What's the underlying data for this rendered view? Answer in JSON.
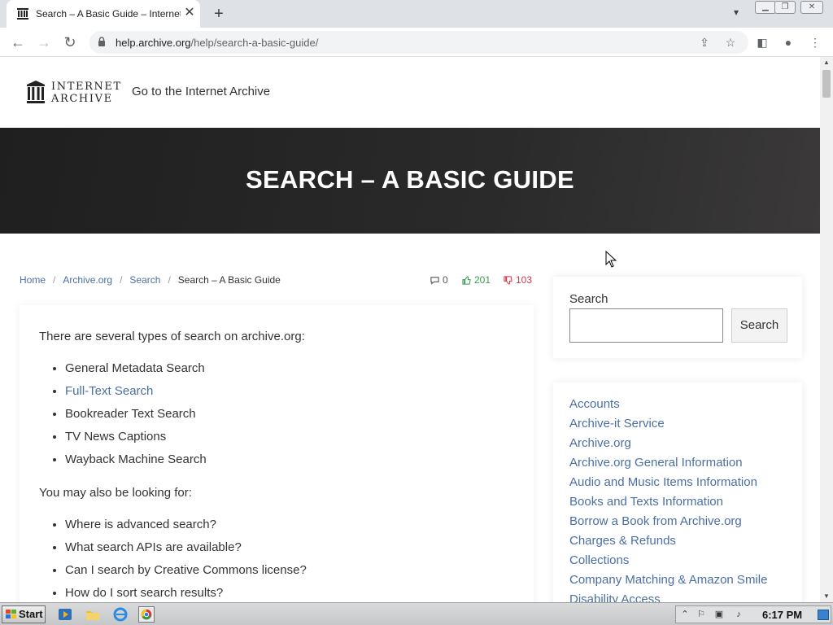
{
  "browser": {
    "tab_title": "Search – A Basic Guide – Internet Archive Help Center",
    "url_host": "help.archive.org",
    "url_path": "/help/search-a-basic-guide/"
  },
  "site": {
    "logo_line1": "INTERNET",
    "logo_line2": "ARCHIVE",
    "goto_link": "Go to the Internet Archive"
  },
  "hero": {
    "title": "SEARCH – A BASIC GUIDE"
  },
  "breadcrumb": [
    {
      "label": "Home"
    },
    {
      "label": "Archive.org"
    },
    {
      "label": "Search"
    },
    {
      "label": "Search – A Basic Guide"
    }
  ],
  "meta": {
    "comments": "0",
    "likes": "201",
    "dislikes": "103"
  },
  "article": {
    "intro": "There are several types of search on archive.org:",
    "search_types": [
      {
        "label": "General Metadata Search"
      },
      {
        "label": "Full-Text Search"
      },
      {
        "label": "Bookreader Text Search"
      },
      {
        "label": "TV News Captions"
      },
      {
        "label": "Wayback Machine Search"
      }
    ],
    "also_heading": "You may also be looking for:",
    "also_items": [
      {
        "label": "Where is advanced search?"
      },
      {
        "label": "What search APIs are available?"
      },
      {
        "label": "Can I search by Creative Commons license?"
      },
      {
        "label": "How do I sort search results?"
      }
    ]
  },
  "sidebar": {
    "search_label": "Search",
    "search_button": "Search",
    "search_value": "",
    "categories": [
      {
        "label": "Accounts"
      },
      {
        "label": "Archive-it Service"
      },
      {
        "label": "Archive.org"
      },
      {
        "label": "Archive.org General Information"
      },
      {
        "label": "Audio and Music Items Information"
      },
      {
        "label": "Books and Texts Information"
      },
      {
        "label": "Borrow a Book from Archive.org"
      },
      {
        "label": "Charges & Refunds"
      },
      {
        "label": "Collections"
      },
      {
        "label": "Company Matching & Amazon Smile"
      },
      {
        "label": "Disability Access"
      }
    ]
  },
  "taskbar": {
    "start_label": "Start",
    "clock": "6:17 PM"
  },
  "colors": {
    "link": "#4a6fa5",
    "like": "#3b9b4f",
    "dislike": "#d9344a",
    "hero_bg": "#222222"
  }
}
